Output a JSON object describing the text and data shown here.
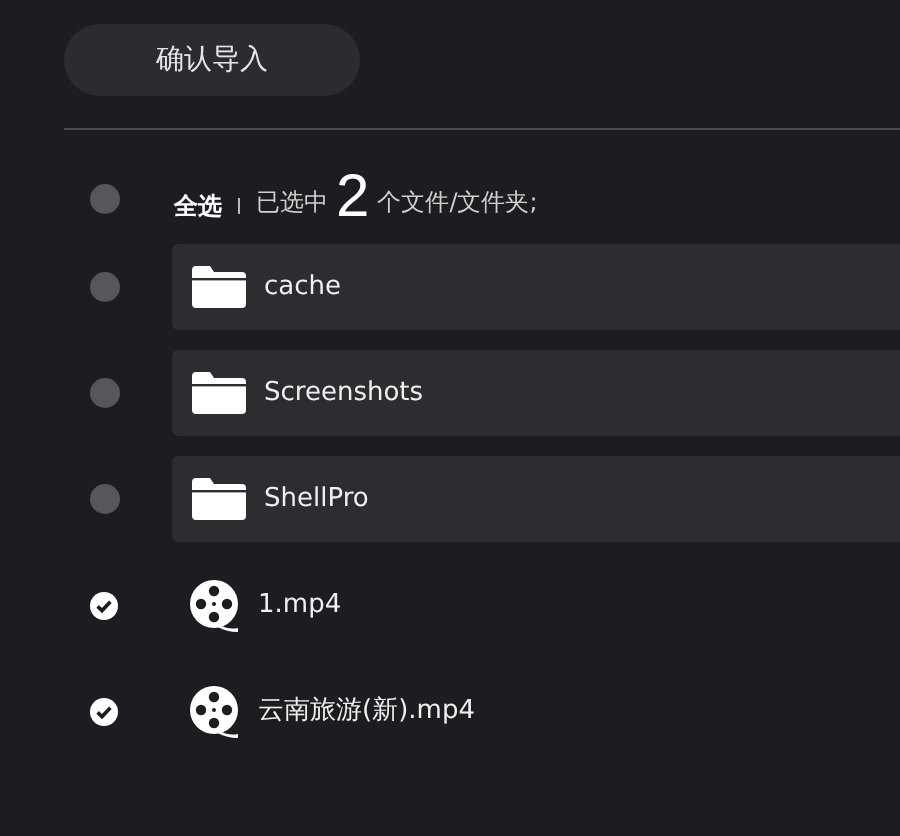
{
  "confirm_button": "确认导入",
  "header": {
    "select_all": {
      "label": "全选",
      "selected": false
    },
    "prefix": "已选中",
    "count": "2",
    "suffix": "个文件/文件夹;"
  },
  "items": [
    {
      "kind": "folder",
      "name": "cache",
      "selected": false
    },
    {
      "kind": "folder",
      "name": "Screenshots",
      "selected": false
    },
    {
      "kind": "folder",
      "name": "ShellPro",
      "selected": false
    },
    {
      "kind": "video",
      "name": "1.mp4",
      "selected": true
    },
    {
      "kind": "video",
      "name": "云南旅游(新).mp4",
      "selected": true
    }
  ]
}
